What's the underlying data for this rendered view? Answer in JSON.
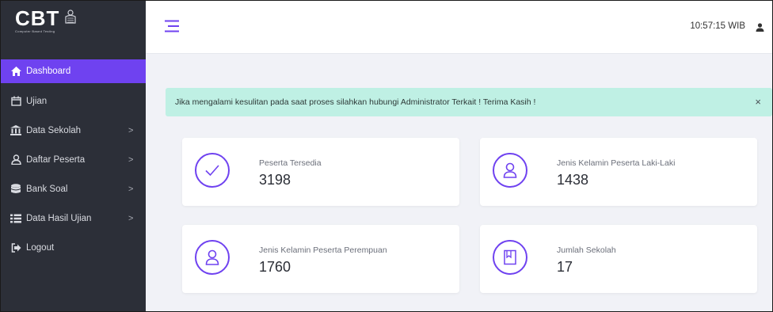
{
  "brand": {
    "name": "CBT",
    "tagline": "Computer Based Testing"
  },
  "colors": {
    "accent": "#6f42f0",
    "sidebar": "#2c2f38",
    "alert_bg": "#bff0e4"
  },
  "sidebar": {
    "items": [
      {
        "label": "Dashboard",
        "icon": "home-icon",
        "active": true,
        "has_children": false
      },
      {
        "label": "Ujian",
        "icon": "calendar-icon",
        "active": false,
        "has_children": false
      },
      {
        "label": "Data Sekolah",
        "icon": "bank-icon",
        "active": false,
        "has_children": true
      },
      {
        "label": "Daftar Peserta",
        "icon": "user-icon",
        "active": false,
        "has_children": true
      },
      {
        "label": "Bank Soal",
        "icon": "database-icon",
        "active": false,
        "has_children": true
      },
      {
        "label": "Data Hasil Ujian",
        "icon": "list-icon",
        "active": false,
        "has_children": true
      },
      {
        "label": "Logout",
        "icon": "sign-out-icon",
        "active": false,
        "has_children": false
      }
    ],
    "chevron": ">"
  },
  "header": {
    "clock": "10:57:15 WIB"
  },
  "alert": {
    "text": "Jika mengalami kesulitan pada saat proses silahkan hubungi Administrator Terkait ! Terima Kasih !",
    "close": "×"
  },
  "cards": [
    {
      "label": "Peserta Tersedia",
      "value": "3198",
      "icon": "check-icon"
    },
    {
      "label": "Jenis Kelamin Peserta Laki-Laki",
      "value": "1438",
      "icon": "person-icon"
    },
    {
      "label": "Jenis Kelamin Peserta Perempuan",
      "value": "1760",
      "icon": "person-icon"
    },
    {
      "label": "Jumlah Sekolah",
      "value": "17",
      "icon": "book-icon"
    }
  ]
}
